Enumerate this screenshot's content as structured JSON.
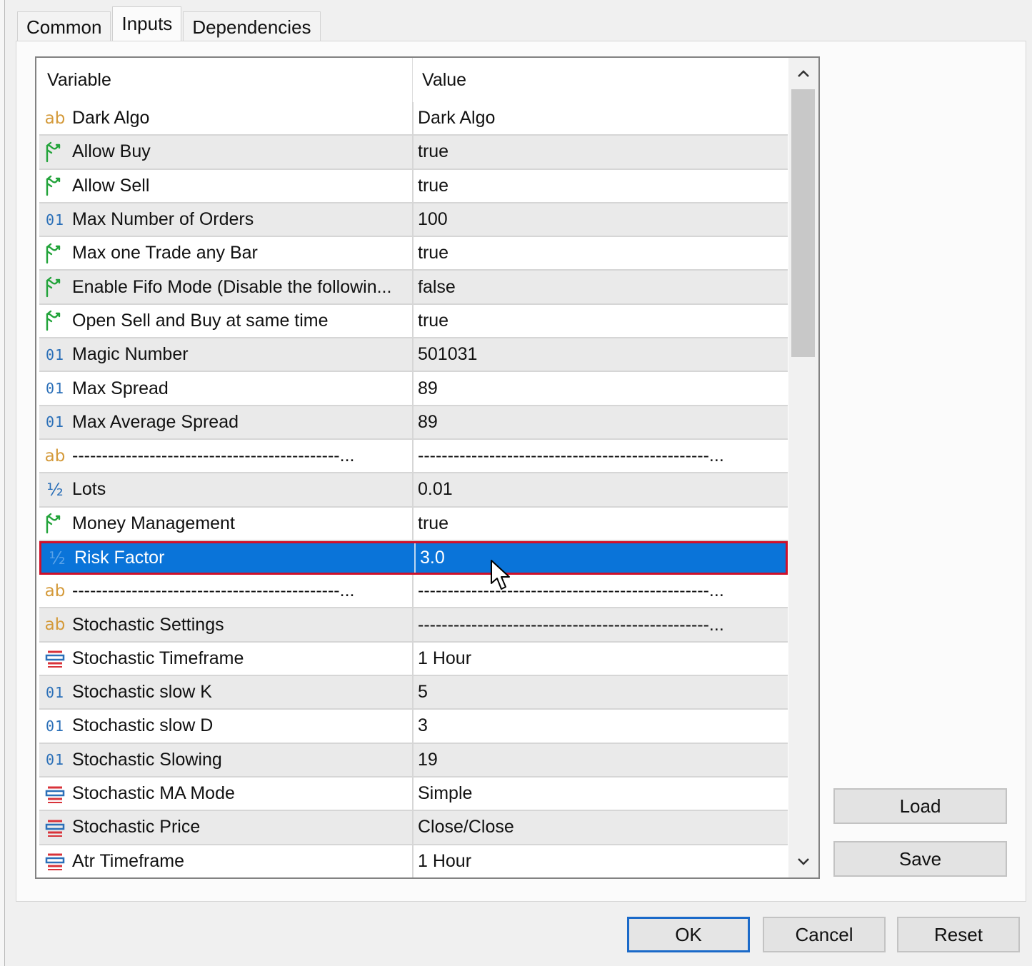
{
  "tabs": [
    {
      "label": "Common"
    },
    {
      "label": "Inputs",
      "active": true
    },
    {
      "label": "Dependencies"
    }
  ],
  "grid": {
    "header": {
      "variable": "Variable",
      "value": "Value"
    },
    "rows": [
      {
        "icon": "string-icon",
        "name": "Dark Algo",
        "value": "Dark Algo"
      },
      {
        "icon": "bool-icon",
        "name": "Allow Buy",
        "value": "true"
      },
      {
        "icon": "bool-icon",
        "name": "Allow Sell",
        "value": "true"
      },
      {
        "icon": "int-icon",
        "name": "Max Number of Orders",
        "value": "100"
      },
      {
        "icon": "bool-icon",
        "name": "Max one Trade any Bar",
        "value": "true"
      },
      {
        "icon": "bool-icon",
        "name": "Enable Fifo Mode (Disable the followin...",
        "value": "false"
      },
      {
        "icon": "bool-icon",
        "name": "Open Sell and Buy at same time",
        "value": "true"
      },
      {
        "icon": "int-icon",
        "name": "Magic Number",
        "value": "501031"
      },
      {
        "icon": "int-icon",
        "name": "Max Spread",
        "value": "89"
      },
      {
        "icon": "int-icon",
        "name": "Max Average Spread",
        "value": "89"
      },
      {
        "icon": "string-icon",
        "name": "---------------------------------------------...",
        "value": "-------------------------------------------------..."
      },
      {
        "icon": "double-icon",
        "name": "Lots",
        "value": "0.01"
      },
      {
        "icon": "bool-icon",
        "name": "Money Management",
        "value": "true"
      },
      {
        "icon": "double-icon",
        "name": "Risk Factor",
        "value": "3.0",
        "selected": true
      },
      {
        "icon": "string-icon",
        "name": "---------------------------------------------...",
        "value": "-------------------------------------------------..."
      },
      {
        "icon": "string-icon",
        "name": "Stochastic Settings",
        "value": "-------------------------------------------------..."
      },
      {
        "icon": "enum-icon",
        "name": "Stochastic Timeframe",
        "value": "1 Hour"
      },
      {
        "icon": "int-icon",
        "name": "Stochastic slow K",
        "value": "5"
      },
      {
        "icon": "int-icon",
        "name": "Stochastic slow D",
        "value": "3"
      },
      {
        "icon": "int-icon",
        "name": "Stochastic Slowing",
        "value": "19"
      },
      {
        "icon": "enum-icon",
        "name": "Stochastic MA Mode",
        "value": "Simple"
      },
      {
        "icon": "enum-icon",
        "name": "Stochastic Price",
        "value": "Close/Close"
      },
      {
        "icon": "enum-icon",
        "name": "Atr Timeframe",
        "value": "1 Hour"
      }
    ]
  },
  "icon_glyphs": {
    "string": "ab",
    "int": "01",
    "double": "½"
  },
  "side_buttons": {
    "load": "Load",
    "save": "Save"
  },
  "dialog_buttons": {
    "ok": "OK",
    "cancel": "Cancel",
    "reset": "Reset"
  },
  "colors": {
    "selection": "#0a74d9",
    "selection_outline": "#d0102a",
    "bool_icon": "#22a33a",
    "int_icon": "#2a6fb8",
    "string_icon": "#d49a3a",
    "enum_icon_red": "#d8333a",
    "enum_icon_blue": "#2a6fb8",
    "ok_border": "#1b6ac9"
  }
}
